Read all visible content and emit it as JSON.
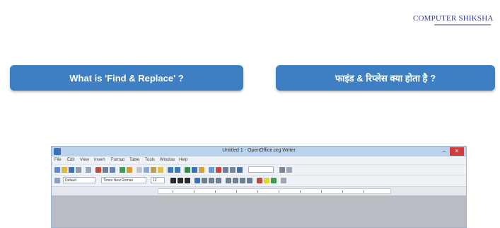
{
  "logo": {
    "text": "COMPUTER SHIKSHA"
  },
  "buttons": {
    "english": "What is 'Find & Replace' ?",
    "hindi": "फाइंड & रिप्लेस क्या होता है ?"
  },
  "app": {
    "title": "Untitled 1 - OpenOffice.org Writer",
    "menus": [
      "File",
      "Edit",
      "View",
      "Insert",
      "Format",
      "Table",
      "Tools",
      "Window",
      "Help"
    ],
    "style_value": "Default",
    "font_value": "Times New Roman",
    "size_value": "12"
  },
  "colors": {
    "button_blue": "#3d7fc2",
    "close_red": "#d23b3b",
    "logo_blue": "#2b3a8c"
  }
}
